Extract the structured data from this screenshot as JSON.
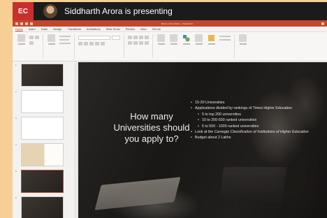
{
  "meeting": {
    "badge": "EC",
    "presenter_text": "Siddharth Arora is presenting"
  },
  "window": {
    "title": "Book Lecture Slides – PowerPoint"
  },
  "menu": {
    "items": [
      "Home",
      "Insert",
      "Draw",
      "Design",
      "Transitions",
      "Animations",
      "Slide Show",
      "Review",
      "View",
      "Tell me"
    ]
  },
  "thumbnails": {
    "numbers": [
      "1",
      "2",
      "3",
      "4",
      "5",
      "6"
    ]
  },
  "slide": {
    "question": "How many Universities should you apply to?",
    "bullets": [
      {
        "level": 1,
        "text": "15-20 Universities"
      },
      {
        "level": 1,
        "text": "Applications divided by rankings of Times Higher Education"
      },
      {
        "level": 2,
        "text": "5 to top 200 universities"
      },
      {
        "level": 2,
        "text": "10 to 200-500 ranked universities"
      },
      {
        "level": 2,
        "text": "5 to 500 - 1000 ranked universities"
      },
      {
        "level": 1,
        "text_prefix": "Look at the ",
        "text_italic": "Carnegie Classification of Institutions of Higher Education"
      },
      {
        "level": 1,
        "text": "Budget about 2 Lakhs"
      }
    ]
  },
  "colors": {
    "accent": "#c2472b",
    "frame": "#f6cf94",
    "meeting_bar": "#1b1b1b"
  }
}
